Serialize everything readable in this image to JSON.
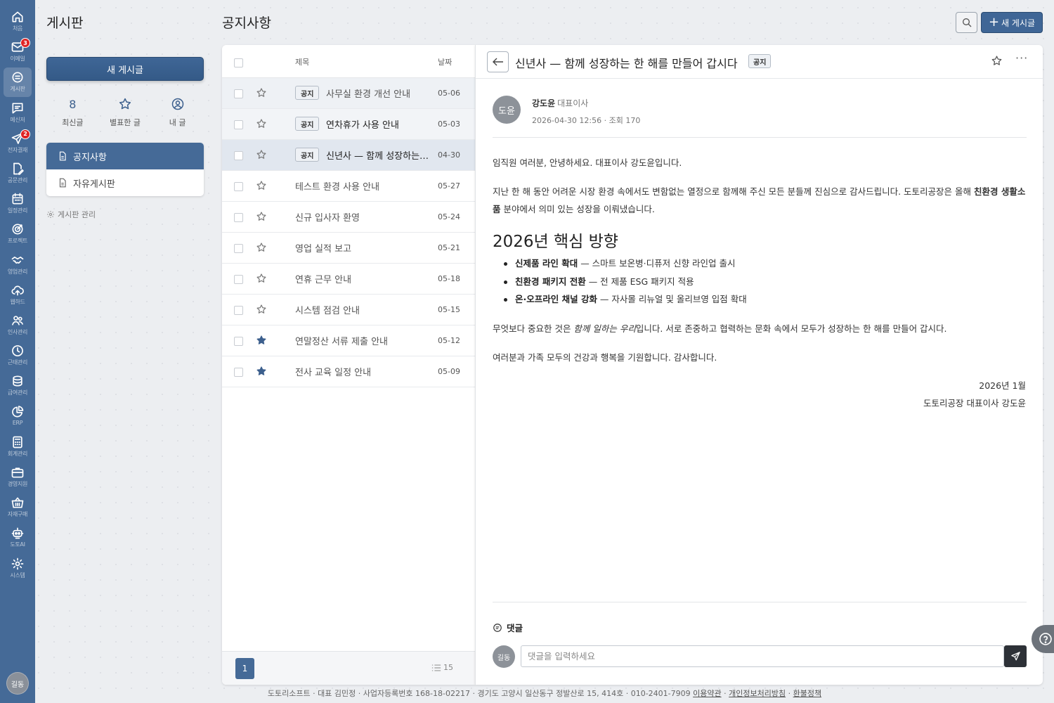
{
  "rail": {
    "items": [
      {
        "label": "처음",
        "icon": "home-icon",
        "badge": ""
      },
      {
        "label": "이메일",
        "icon": "mail-icon",
        "badge": "3"
      },
      {
        "label": "게시판",
        "icon": "board-icon",
        "badge": ""
      },
      {
        "label": "메신저",
        "icon": "chat-icon",
        "badge": ""
      },
      {
        "label": "전자결재",
        "icon": "send-icon",
        "badge": "2"
      },
      {
        "label": "공문관리",
        "icon": "doc-edit-icon",
        "badge": ""
      },
      {
        "label": "일정관리",
        "icon": "calendar-icon",
        "badge": ""
      },
      {
        "label": "프로젝트",
        "icon": "target-icon",
        "badge": ""
      },
      {
        "label": "영업관리",
        "icon": "handshake-icon",
        "badge": ""
      },
      {
        "label": "웹하드",
        "icon": "cloud-upload-icon",
        "badge": ""
      },
      {
        "label": "인사관리",
        "icon": "people-icon",
        "badge": ""
      },
      {
        "label": "근태관리",
        "icon": "clock-icon",
        "badge": ""
      },
      {
        "label": "급여관리",
        "icon": "coins-icon",
        "badge": ""
      },
      {
        "label": "ERP",
        "icon": "pie-chart-icon",
        "badge": ""
      },
      {
        "label": "회계관리",
        "icon": "calculator-icon",
        "badge": ""
      },
      {
        "label": "경영지원",
        "icon": "briefcase-icon",
        "badge": ""
      },
      {
        "label": "자재구매",
        "icon": "basket-icon",
        "badge": ""
      },
      {
        "label": "도토AI",
        "icon": "robot-icon",
        "badge": ""
      },
      {
        "label": "시스템",
        "icon": "gear-icon",
        "badge": ""
      }
    ],
    "active_index": 2,
    "avatar": "길동"
  },
  "sidebar": {
    "title": "게시판",
    "new_post": "새 게시글",
    "stats": [
      {
        "value": "8",
        "label": "최신글"
      },
      {
        "icon": "star-icon",
        "label": "별표한 글"
      },
      {
        "icon": "user-circle-icon",
        "label": "내 글"
      }
    ],
    "boards": [
      {
        "label": "공지사항",
        "active": true
      },
      {
        "label": "자유게시판",
        "active": false
      }
    ],
    "manage": "게시판 관리"
  },
  "header": {
    "title": "공지사항",
    "write_label": "새 게시글",
    "write_plus": "+"
  },
  "list": {
    "col_title": "제목",
    "col_date": "날짜",
    "rows": [
      {
        "tag": "공지",
        "title": "사무실 환경 개선 안내",
        "date": "05-06",
        "starred": false
      },
      {
        "tag": "공지",
        "title": "연차휴가 사용 안내",
        "date": "05-03",
        "starred": false
      },
      {
        "tag": "공지",
        "title": "신년사 — 함께 성장하는 한 해를 만들어 갑시다",
        "date": "04-30",
        "starred": false
      },
      {
        "tag": "",
        "title": "테스트 환경 사용 안내",
        "date": "05-27",
        "starred": false
      },
      {
        "tag": "",
        "title": "신규 입사자 환영",
        "date": "05-24",
        "starred": false
      },
      {
        "tag": "",
        "title": "영업 실적 보고",
        "date": "05-21",
        "starred": false
      },
      {
        "tag": "",
        "title": "연휴 근무 안내",
        "date": "05-18",
        "starred": false
      },
      {
        "tag": "",
        "title": "시스템 점검 안내",
        "date": "05-15",
        "starred": false
      },
      {
        "tag": "",
        "title": "연말정산 서류 제출 안내",
        "date": "05-12",
        "starred": true
      },
      {
        "tag": "",
        "title": "전사 교육 일정 안내",
        "date": "05-09",
        "starred": true
      }
    ],
    "page": "1",
    "per_page": "15"
  },
  "detail": {
    "title": "신년사 — 함께 성장하는 한 해를 만들어 갑시다",
    "tag": "공지",
    "more": "···",
    "author_avatar": "도윤",
    "author_name": "강도윤",
    "author_role": "대표이사",
    "meta": "2026-04-30 12:56 · 조회 170",
    "p1": "임직원 여러분, 안녕하세요. 대표이사 강도윤입니다.",
    "p2_a": "지난 한 해 동안 어려운 시장 환경 속에서도 변함없는 열정으로 함께해 주신 모든 분들께 진심으로 감사드립니다. 도토리공장은 올해 ",
    "p2_bold": "친환경 생활소품",
    "p2_b": " 분야에서 의미 있는 성장을 이뤄냈습니다.",
    "heading": "2026년 핵심 방향",
    "bullets": [
      {
        "bold": "신제품 라인 확대",
        "text": " — 스마트 보온병·디퓨저 신향 라인업 출시"
      },
      {
        "bold": "친환경 패키지 전환",
        "text": " — 전 제품 ESG 패키지 적용"
      },
      {
        "bold": "온·오프라인 채널 강화",
        "text": " — 자사몰 리뉴얼 및 올리브영 입점 확대"
      }
    ],
    "p3_a": "무엇보다 중요한 것은 ",
    "p3_em": "함께 일하는 우리",
    "p3_b": "입니다. 서로 존중하고 협력하는 문화 속에서 모두가 성장하는 한 해를 만들어 갑시다.",
    "p4": "여러분과 가족 모두의 건강과 행복을 기원합니다. 감사합니다.",
    "sign_date": "2026년 1월",
    "sign_name": "도토리공장 대표이사 강도윤"
  },
  "comments": {
    "title": "댓글",
    "avatar": "길동",
    "placeholder": "댓글을 입력하세요"
  },
  "footer": {
    "text": "도토리소프트 · 대표 김민정 · 사업자등록번호 168-18-02217 · 경기도 고양시 일산동구 정발산로 15, 414호 · 010-2401-7909 ",
    "link1": "이용약관",
    "link2": "개인정보처리방침",
    "link3": "환불정책",
    "sep": " · "
  },
  "colors": {
    "rail": "#456a97",
    "accent": "#3f6696",
    "badge": "#e02424"
  }
}
